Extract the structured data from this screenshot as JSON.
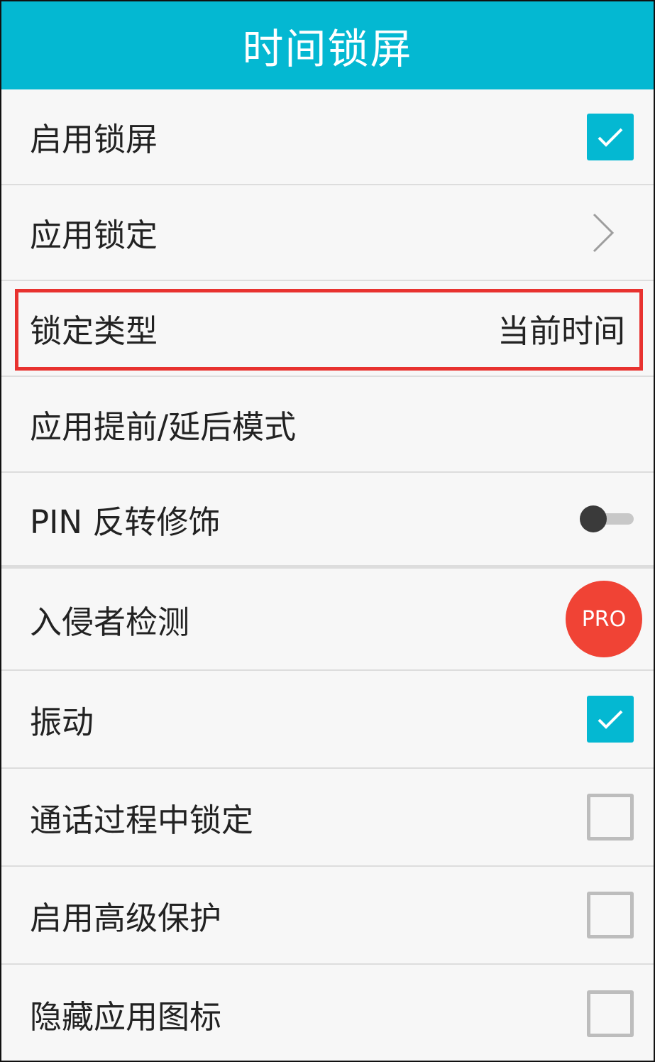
{
  "header": {
    "title": "时间锁屏"
  },
  "colors": {
    "accent": "#04b8d2",
    "pro_badge": "#f04335",
    "highlight": "#e8322f"
  },
  "settings": [
    {
      "label": "启用锁屏",
      "control": "checkbox",
      "checked": true
    },
    {
      "label": "应用锁定",
      "control": "chevron-right-icon"
    },
    {
      "label": "锁定类型",
      "value": "当前时间"
    },
    {
      "label": "应用提前/延后模式"
    },
    {
      "label": "PIN 反转修饰",
      "control": "toggle",
      "on": false
    },
    {
      "label": "入侵者检测",
      "badge": "PRO"
    },
    {
      "label": "振动",
      "control": "checkbox",
      "checked": true
    },
    {
      "label": "通话过程中锁定",
      "control": "checkbox",
      "checked": false
    },
    {
      "label": "启用高级保护",
      "control": "checkbox",
      "checked": false
    },
    {
      "label": "隐藏应用图标",
      "control": "checkbox",
      "checked": false
    }
  ]
}
